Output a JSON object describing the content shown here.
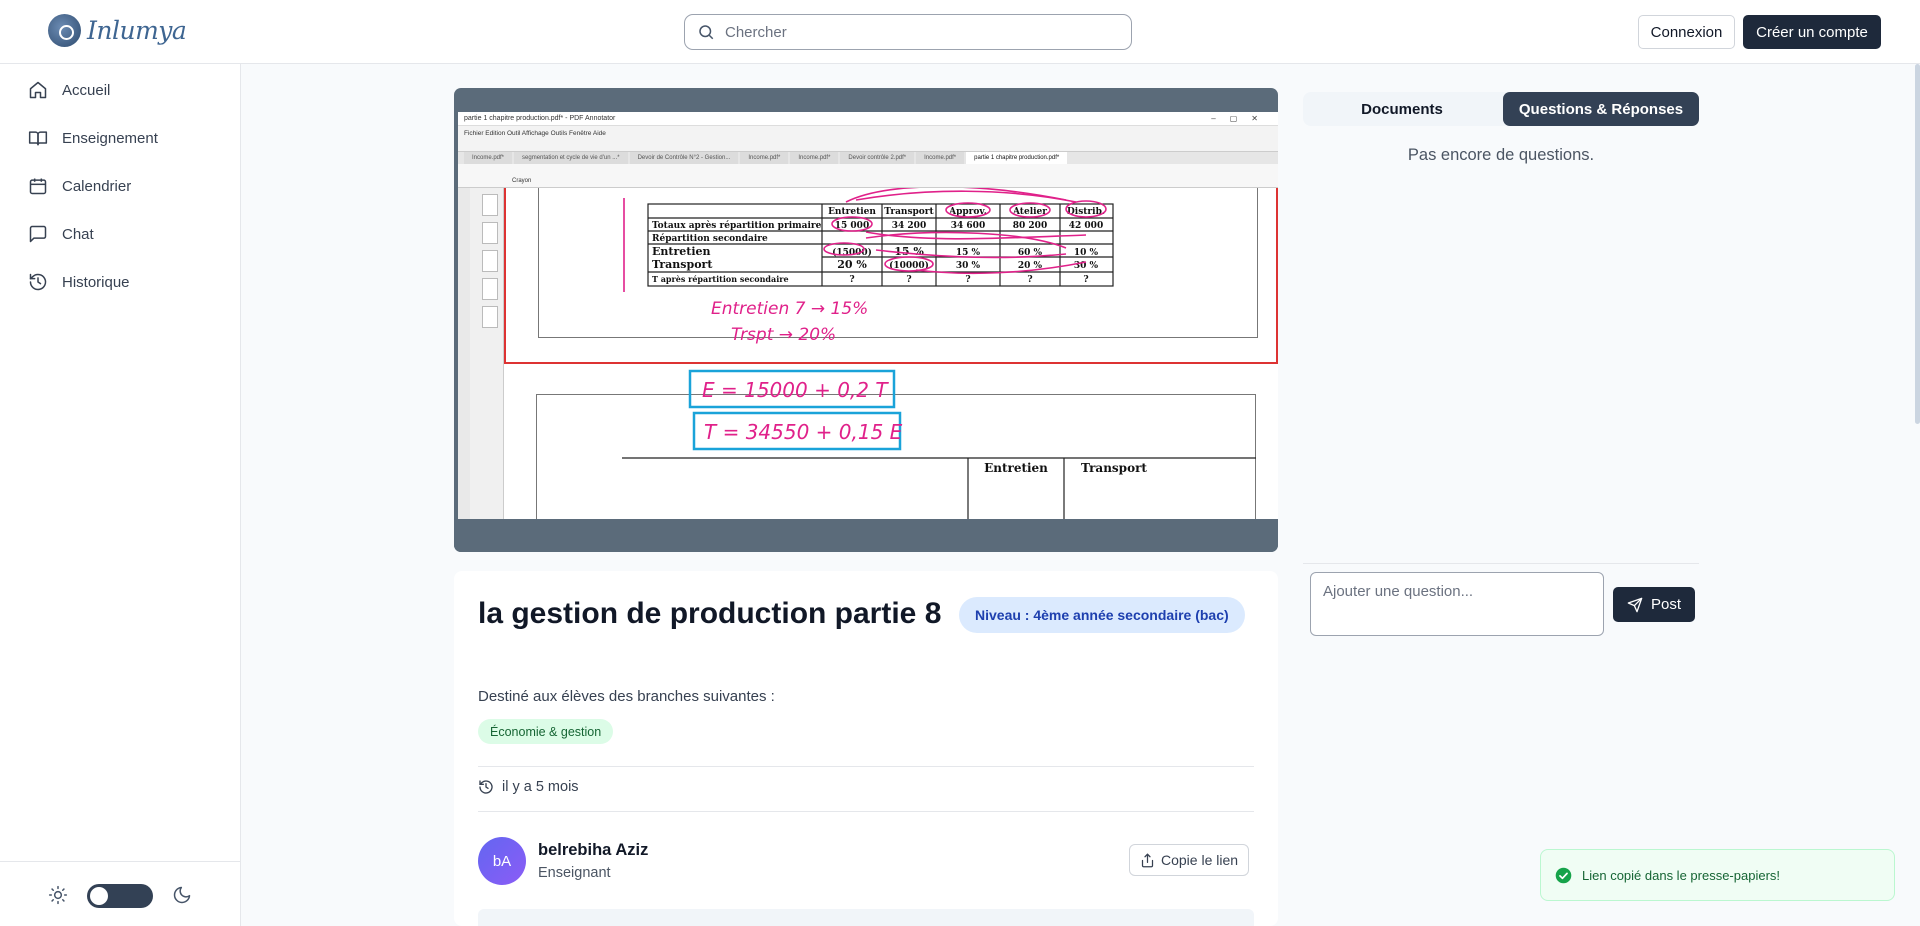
{
  "header": {
    "logo_text": "Inlumya",
    "search_placeholder": "Chercher",
    "login_label": "Connexion",
    "signup_label": "Créer un compte"
  },
  "sidebar": {
    "items": [
      {
        "label": "Accueil",
        "icon": "home-icon"
      },
      {
        "label": "Enseignement",
        "icon": "book-icon"
      },
      {
        "label": "Calendrier",
        "icon": "calendar-icon"
      },
      {
        "label": "Chat",
        "icon": "chat-icon"
      },
      {
        "label": "Historique",
        "icon": "history-icon"
      }
    ],
    "theme_toggle": {
      "mode": "light"
    }
  },
  "video": {
    "window_title": "partie 1 chapitre production.pdf* - PDF Annotator",
    "menu": "Fichier   Edition   Outil   Affichage   Outils   Fenêtre   Aide",
    "tabs": [
      "Income.pdf*",
      "segmentation et cycle de vie d'un ...*",
      "Devoir de Contrôle N°2 - Gestion...",
      "Income.pdf*",
      "Income.pdf*",
      "Devoir contrôle 2.pdf*",
      "Income.pdf*",
      "partie 1 chapitre production.pdf*"
    ],
    "tool_label": "Crayon",
    "table": {
      "headers": [
        "",
        "Entretien",
        "Transport",
        "Approv.",
        "Atelier",
        "Distrib."
      ],
      "rows": [
        [
          "Totaux après répartition primaire",
          "15 000",
          "34 200",
          "34 600",
          "80 200",
          "42 000"
        ],
        [
          "Répartition secondaire",
          "",
          "",
          "",
          "",
          ""
        ],
        [
          "Entretien",
          "(15000)",
          "15 %",
          "15 %",
          "60 %",
          "10 %"
        ],
        [
          "Transport",
          "20 %",
          "(10000)",
          "30 %",
          "20 %",
          "30 %"
        ],
        [
          "T après répartition secondaire",
          "?",
          "?",
          "?",
          "?",
          "?"
        ]
      ]
    },
    "handwriting": {
      "line1": "Entretien  7  →  15%",
      "line2": "Trspt  →  20%",
      "eq1": "E = 15000 + 0,2 T",
      "eq2": "T = 34550 + 0,15 E"
    },
    "page2_headers": [
      "Entretien",
      "Transport"
    ]
  },
  "course": {
    "title": "la gestion de production partie 8",
    "level_badge": "Niveau : 4ème année secondaire (bac)",
    "branch_intro": "Destiné aux élèves des branches suivantes :",
    "branch_badge": "Économie & gestion",
    "time_ago": "il y a 5 mois",
    "author": {
      "initials": "bA",
      "name": "belrebiha Aziz",
      "role": "Enseignant"
    },
    "copy_label": "Copie le lien"
  },
  "panel": {
    "tab_docs": "Documents",
    "tab_qa": "Questions & Réponses",
    "active_tab": "Questions & Réponses",
    "empty_text": "Pas encore de questions.",
    "question_placeholder": "Ajouter une question...",
    "post_label": "Post"
  },
  "toast": {
    "message": "Lien copié dans le presse-papiers!"
  },
  "colors": {
    "primary": "#1e293b",
    "accent": "#334155",
    "success": "#166534",
    "annotation": "#e0218a",
    "box": "#1aa3d9"
  }
}
